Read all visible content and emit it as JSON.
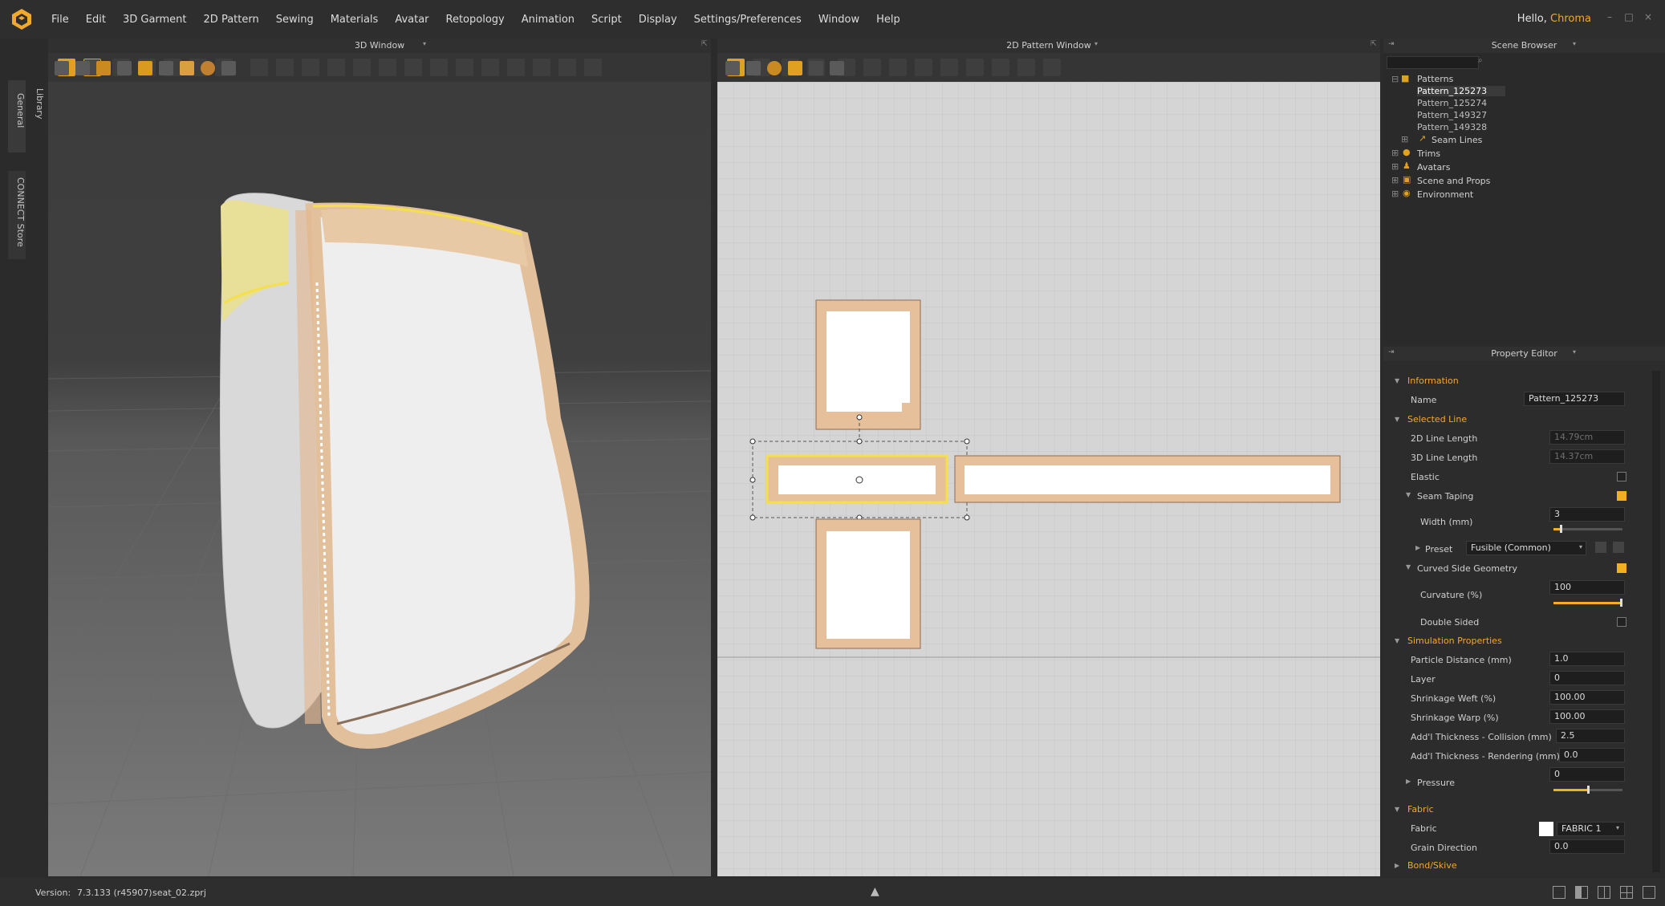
{
  "menubar": {
    "items": [
      "File",
      "Edit",
      "3D Garment",
      "2D Pattern",
      "Sewing",
      "Materials",
      "Avatar",
      "Retopology",
      "Animation",
      "Script",
      "Display",
      "Settings/Preferences",
      "Window",
      "Help"
    ],
    "greeting": "Hello,",
    "user": "Chroma"
  },
  "sidetabs": {
    "general": "General",
    "library": "Library",
    "connect": "CONNECT Store"
  },
  "panels": {
    "view3d_title": "3D Window",
    "view2d_title": "2D Pattern Window",
    "scene_title": "Scene Browser",
    "prop_title": "Property Editor"
  },
  "scene": {
    "items": [
      {
        "label": "Patterns",
        "icon": "folder-icon"
      },
      {
        "label": "Pattern_125273",
        "icon": "pattern-icon"
      },
      {
        "label": "Pattern_125274",
        "icon": "pattern-icon"
      },
      {
        "label": "Pattern_149327",
        "icon": "pattern-icon"
      },
      {
        "label": "Pattern_149328",
        "icon": "pattern-icon"
      },
      {
        "label": "Seam Lines",
        "icon": "seam-icon"
      },
      {
        "label": "Trims",
        "icon": "trim-icon"
      },
      {
        "label": "Avatars",
        "icon": "avatar-icon"
      },
      {
        "label": "Scene and Props",
        "icon": "props-icon"
      },
      {
        "label": "Environment",
        "icon": "environment-icon"
      }
    ]
  },
  "prop": {
    "information": "Information",
    "name_label": "Name",
    "name_value": "Pattern_125273",
    "selected_line": "Selected Line",
    "line2d_label": "2D Line Length",
    "line2d_value": "14.79cm",
    "line3d_label": "3D Line Length",
    "line3d_value": "14.37cm",
    "elastic_label": "Elastic",
    "seam_taping_label": "Seam Taping",
    "width_label": "Width (mm)",
    "width_value": "3",
    "preset_label": "Preset",
    "preset_value": "Fusible (Common)",
    "curved_label": "Curved Side Geometry",
    "curvature_label": "Curvature (%)",
    "curvature_value": "100",
    "double_sided_label": "Double Sided",
    "simulation": "Simulation Properties",
    "particle_label": "Particle Distance (mm)",
    "particle_value": "1.0",
    "layer_label": "Layer",
    "layer_value": "0",
    "weft_label": "Shrinkage Weft (%)",
    "weft_value": "100.00",
    "warp_label": "Shrinkage Warp (%)",
    "warp_value": "100.00",
    "collision_label": "Add'l Thickness - Collision (mm)",
    "collision_value": "2.5",
    "rendering_label": "Add'l Thickness - Rendering (mm)",
    "rendering_value": "0.0",
    "pressure_label": "Pressure",
    "pressure_value": "0",
    "fabric_section": "Fabric",
    "fabric_label": "Fabric",
    "fabric_value": "FABRIC 1",
    "grain_label": "Grain Direction",
    "grain_value": "0.0",
    "bond_section": "Bond/Skive"
  },
  "states": {
    "elastic": false,
    "seam_taping": true,
    "curved": true,
    "double_sided": false,
    "width_slider": 0.1,
    "curvature_slider": 1.0,
    "pressure_slider": 0.5
  },
  "status": {
    "version_label": "Version:",
    "version_value": "7.3.133 (r45907)",
    "file": "seat_02.zprj"
  },
  "colors": {
    "accent": "#f0a830",
    "seam": "#e8c9a6",
    "highlight": "#f5e04a"
  }
}
